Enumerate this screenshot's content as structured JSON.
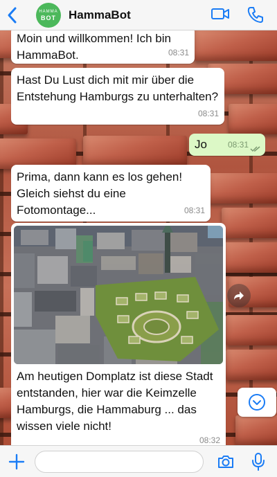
{
  "header": {
    "avatar_line1": "HAMMA",
    "avatar_line2": "BOT",
    "title": "HammaBot"
  },
  "messages": [
    {
      "text": "Moin und willkommen! Ich bin HammaBot.",
      "time": "08:31",
      "direction": "in"
    },
    {
      "text": "Hast Du Lust dich mit mir über die Entstehung Hamburgs zu unterhalten?",
      "time": "08:31",
      "direction": "in"
    },
    {
      "text": "Jo",
      "time": "08:31",
      "direction": "out",
      "status": "read"
    },
    {
      "text": "Prima, dann kann es los gehen! Gleich siehst du eine Fotomontage...",
      "time": "08:31",
      "direction": "in"
    },
    {
      "image": "aerial-photo-domplatz",
      "text": "Am heutigen Domplatz ist diese Stadt entstanden, hier war die Keimzelle Hamburgs, die Hammaburg ... das wissen viele nicht!",
      "time": "08:32",
      "direction": "in"
    }
  ],
  "input": {
    "placeholder": ""
  },
  "colors": {
    "accent": "#1a7cf5",
    "outgoing_bubble": "#dcf8c6",
    "avatar": "#4cb85b"
  }
}
